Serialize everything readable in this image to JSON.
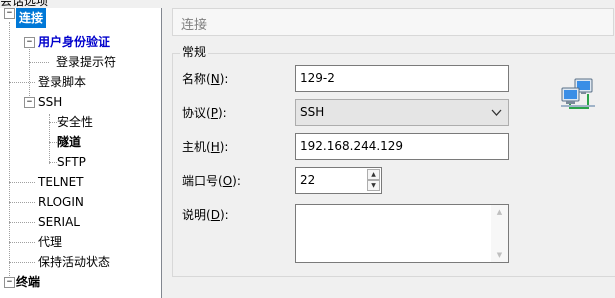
{
  "top_clipped_label": "会话选项",
  "tree": {
    "items": [
      {
        "label": "连接",
        "state": "selected"
      },
      {
        "label": "用户身份验证",
        "state": "highlight"
      },
      {
        "label": "登录提示符"
      },
      {
        "label": "登录脚本"
      },
      {
        "label": "SSH"
      },
      {
        "label": "安全性"
      },
      {
        "label": "隧道",
        "state": "bold"
      },
      {
        "label": "SFTP"
      },
      {
        "label": "TELNET"
      },
      {
        "label": "RLOGIN"
      },
      {
        "label": "SERIAL"
      },
      {
        "label": "代理"
      },
      {
        "label": "保持活动状态"
      },
      {
        "label": "终端"
      }
    ],
    "expander_collapse": "⊟",
    "expander_minus": "−"
  },
  "panel": {
    "title": "连接",
    "group_label": "常规",
    "fields": {
      "name": {
        "label": "名称",
        "key": "N",
        "value": "129-2"
      },
      "protocol": {
        "label": "协议",
        "key": "P",
        "value": "SSH"
      },
      "host": {
        "label": "主机",
        "key": "H",
        "value": "192.168.244.129"
      },
      "port": {
        "label": "端口号",
        "key": "O",
        "value": "22"
      },
      "description": {
        "label": "说明",
        "key": "D",
        "value": ""
      }
    }
  },
  "icons": {
    "network": "network-computers-icon",
    "dropdown": "chevron-down-icon",
    "spin_up": "spin-up-icon",
    "spin_down": "spin-down-icon"
  },
  "colors": {
    "selection": "#0078d7",
    "highlight_text": "#0000cc",
    "panel_bg": "#f0f0f0"
  }
}
